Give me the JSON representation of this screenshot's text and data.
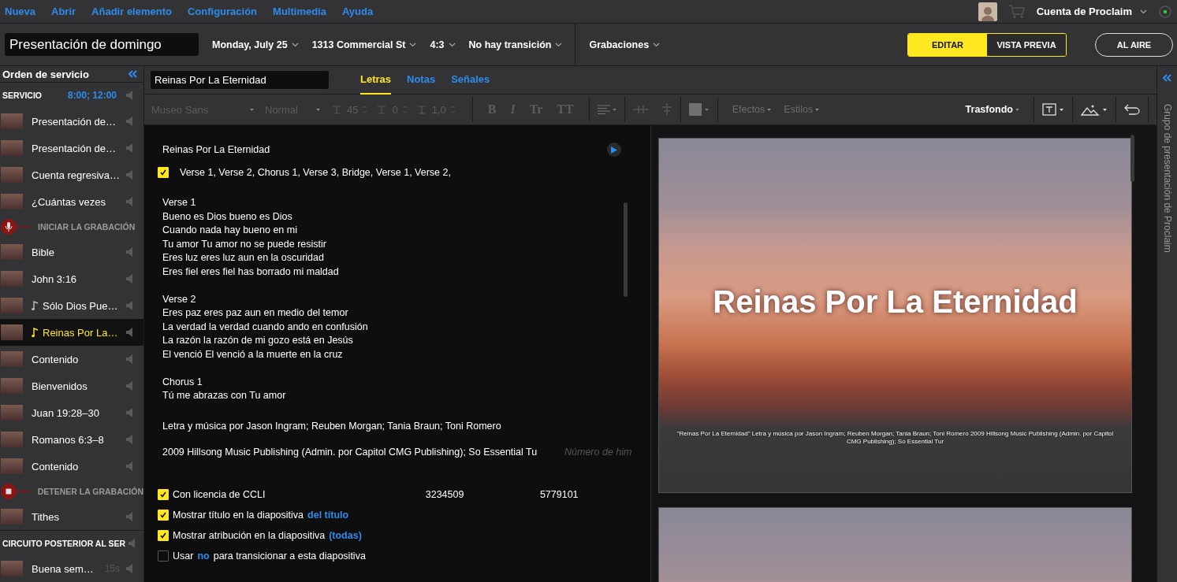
{
  "menu": {
    "items": [
      "Nueva",
      "Abrir",
      "Añadir elemento",
      "Configuración",
      "Multimedia",
      "Ayuda"
    ],
    "account": "Cuenta de Proclaim"
  },
  "header": {
    "title": "Presentación de domingo",
    "dropdowns": [
      "Monday, July 25",
      "1313 Commercial St",
      "4:3",
      "No hay transición"
    ],
    "recordings": "Grabaciones",
    "modes": [
      {
        "label": "EDITAR",
        "selected": true
      },
      {
        "label": "VISTA PREVIA",
        "selected": false
      }
    ],
    "live_button": "AL AIRE"
  },
  "sidebar": {
    "title": "Orden de servicio",
    "items": [
      {
        "kind": "section",
        "label": "SERVICIO",
        "time": "8:00; 12:00"
      },
      {
        "kind": "item",
        "label": "Presentación de…",
        "music": false,
        "selected": false
      },
      {
        "kind": "item",
        "label": "Presentación de…",
        "music": false,
        "selected": false
      },
      {
        "kind": "item",
        "label": "Cuenta regresiva…",
        "music": false,
        "selected": false
      },
      {
        "kind": "item",
        "label": "¿Cuántas vezes",
        "music": false,
        "selected": false
      },
      {
        "kind": "record",
        "label": "INICIAR LA GRABACIÓN"
      },
      {
        "kind": "item",
        "label": "Bible",
        "music": false,
        "selected": false
      },
      {
        "kind": "item",
        "label": "John 3:16",
        "music": false,
        "selected": false
      },
      {
        "kind": "item",
        "label": "Sólo Dios Pue…",
        "music": true,
        "selected": false
      },
      {
        "kind": "item",
        "label": "Reinas Por La…",
        "music": true,
        "selected": true
      },
      {
        "kind": "item",
        "label": "Contenido",
        "music": false,
        "selected": false
      },
      {
        "kind": "item",
        "label": "Bienvenidos",
        "music": false,
        "selected": false
      },
      {
        "kind": "item",
        "label": "Juan 19:28–30",
        "music": false,
        "selected": false
      },
      {
        "kind": "item",
        "label": "Romanos 6:3–8",
        "music": false,
        "selected": false
      },
      {
        "kind": "item",
        "label": "Contenido",
        "music": false,
        "selected": false
      },
      {
        "kind": "stop",
        "label": "DETENER LA GRABACIÓN"
      },
      {
        "kind": "item",
        "label": "Tithes",
        "music": false,
        "selected": false
      },
      {
        "kind": "section",
        "label": "CIRCUITO POSTERIOR AL SER"
      },
      {
        "kind": "item",
        "label": "Buena sem…",
        "duration": "15s",
        "music": false,
        "selected": false
      }
    ]
  },
  "editor": {
    "item_title": "Reinas Por La Eternidad",
    "tabs": [
      {
        "label": "Letras",
        "selected": true
      },
      {
        "label": "Notas",
        "selected": false
      },
      {
        "label": "Señales",
        "selected": false
      }
    ],
    "toolbar": {
      "font": "Museo Sans",
      "weight": "Normal",
      "size": "45",
      "tracking": "0",
      "leading": "1,0",
      "format_buttons": [
        "B",
        "I",
        "Tr",
        "TT"
      ],
      "menus": [
        {
          "label": "Efectos",
          "disabled": true
        },
        {
          "label": "Estilos",
          "disabled": true
        },
        {
          "label": "Trasfondo",
          "disabled": false
        }
      ]
    },
    "song_title": "Reinas Por La Eternidad",
    "arrangement": {
      "checked": true,
      "text": "Verse 1, Verse 2, Chorus 1, Verse 3, Bridge, Verse 1, Verse 2,"
    },
    "lyrics": [
      {
        "heading": "Verse 1",
        "lines": [
          "Bueno es Dios bueno es Dios",
          "Cuando nada hay bueno en mi",
          "Tu amor Tu amor no se puede resistir",
          "Eres luz eres luz aun en la oscuridad",
          "Eres fiel eres fiel has borrado mi maldad"
        ]
      },
      {
        "heading": "Verse 2",
        "lines": [
          "Eres paz eres paz aun en medio del temor",
          "La verdad la verdad cuando ando en confusión",
          "La razón la razón de mi gozo está en Jesús",
          "El venció El venció a la muerte en la cruz"
        ]
      },
      {
        "heading": "Chorus 1",
        "lines": [
          "Tú me abrazas con Tu amor"
        ]
      }
    ],
    "authors": "Letra y música por Jason Ingram; Reuben Morgan; Tania Braun; Toni Romero",
    "copyright": "2009 Hillsong Music Publishing (Admin. por Capitol CMG Publishing); So Essential Tu",
    "hymn_number": {
      "placeholder": "Número de him"
    },
    "options": [
      {
        "checked": true,
        "label": "Con licencia de CCLI",
        "values": [
          "3234509",
          "5779101"
        ]
      },
      {
        "checked": true,
        "label": "Mostrar título en la diapositiva",
        "link": "del título"
      },
      {
        "checked": true,
        "label": "Mostrar atribución en la diapositiva",
        "link": "(todas)"
      },
      {
        "checked": false,
        "label": "Usar",
        "link": "no",
        "after": "para transicionar a esta diapositiva"
      }
    ]
  },
  "preview": {
    "slides": [
      {
        "title": "Reinas Por La Eternidad",
        "footer": "\"Reinas Por La Eternidad\" Letra y música por Jason Ingram; Reuben Morgan; Tania Braun; Toni Romero 2009 Hillsong Music Publishing (Admin. por Capitol CMG Publishing); So Essential Tur"
      }
    ]
  },
  "side_panel": {
    "title": "Grupo de presentación de Proclaim"
  }
}
